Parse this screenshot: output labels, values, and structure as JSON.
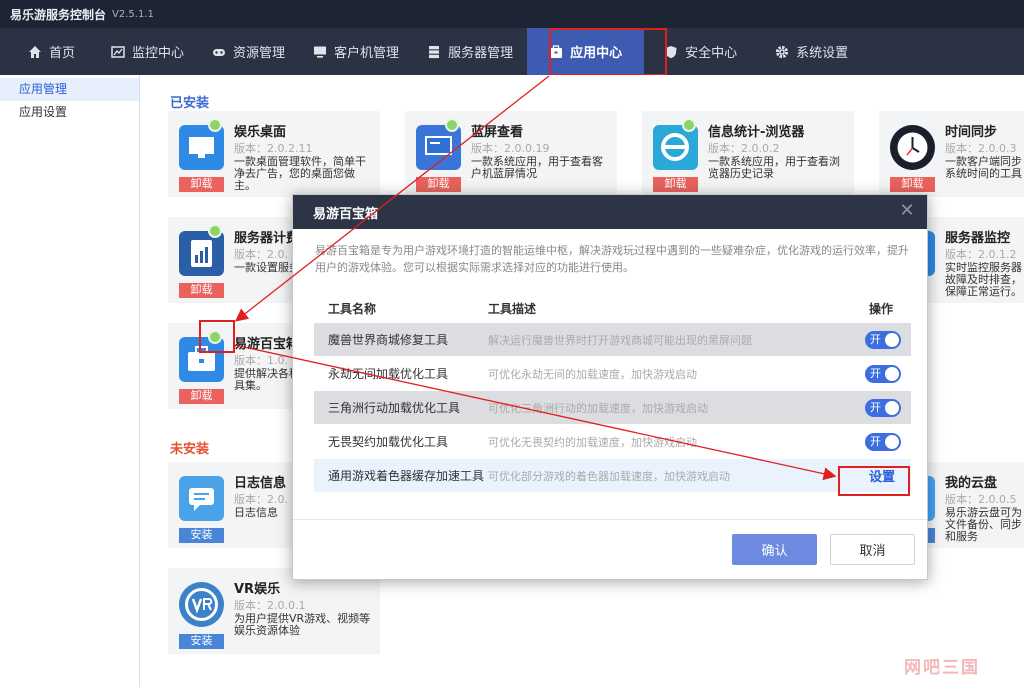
{
  "titlebar": {
    "title": "易乐游服务控制台",
    "version": "V2.5.1.1"
  },
  "nav": [
    {
      "label": "首页",
      "icon": "home-icon"
    },
    {
      "label": "监控中心",
      "icon": "monitor-chart-icon"
    },
    {
      "label": "资源管理",
      "icon": "gamepad-icon"
    },
    {
      "label": "客户机管理",
      "icon": "desktop-icon"
    },
    {
      "label": "服务器管理",
      "icon": "server-icon"
    },
    {
      "label": "应用中心",
      "icon": "box-icon",
      "active": true
    },
    {
      "label": "安全中心",
      "icon": "shield-icon"
    },
    {
      "label": "系统设置",
      "icon": "gear-icon"
    }
  ],
  "sidebar": {
    "items": [
      {
        "label": "应用管理",
        "active": true
      },
      {
        "label": "应用设置"
      }
    ]
  },
  "main": {
    "installed_title": "已安装",
    "uninstalled_title": "未安装",
    "uninstall_label": "卸载",
    "install_label": "安装",
    "installed": [
      {
        "name": "娱乐桌面",
        "version": "版本：2.0.2.11",
        "desc": "一款桌面管理软件，简单干净去广告，您的桌面您做主。",
        "icon": "monitor-app-icon"
      },
      {
        "name": "蓝屏查看",
        "version": "版本：2.0.0.19",
        "desc": "一款系统应用，用于查看客户机蓝屏情况",
        "icon": "bluescreen-app-icon"
      },
      {
        "name": "信息统计-浏览器",
        "version": "版本：2.0.0.2",
        "desc": "一款系统应用，用于查看浏览器历史记录",
        "icon": "browser-app-icon"
      },
      {
        "name": "时间同步",
        "version": "版本：2.0.0.3",
        "desc": "一款客户端同步系统时间的工具",
        "icon": "clock-app-icon"
      },
      {
        "name": "服务器计费",
        "version": "版本：2.0.",
        "desc": "一款设置服务器的工具",
        "icon": "billing-app-icon"
      },
      {
        "name": "服务器监控",
        "version": "版本：2.0.1.2",
        "desc": "实时监控服务器故障及时排查，保障正常运行。",
        "icon": "server-monitor-app-icon"
      },
      {
        "name": "易游百宝箱",
        "version": "版本：1.0.",
        "desc": "提供解决各种游戏问题的工具集。",
        "icon": "toolbox-app-icon"
      }
    ],
    "uninstalled": [
      {
        "name": "日志信息",
        "version": "版本：2.0.",
        "desc": "日志信息",
        "icon": "log-app-icon"
      },
      {
        "name": "我的云盘",
        "version": "版本：2.0.0.5",
        "desc": "易乐游云盘可为文件备份、同步和服务",
        "icon": "cloud-app-icon"
      },
      {
        "name": "VR娱乐",
        "version": "版本：2.0.0.1",
        "desc": "为用户提供VR游戏、视频等娱乐资源体验",
        "icon": "vr-app-icon"
      }
    ]
  },
  "modal": {
    "title": "易游百宝箱",
    "intro": "易游百宝箱是专为用户游戏环境打造的智能运维中枢，解决游戏玩过程中遇到的一些疑难杂症，优化游戏的运行效率，提升用户的游戏体验。您可以根据实际需求选择对应的功能进行使用。",
    "col_name": "工具名称",
    "col_desc": "工具描述",
    "col_op": "操作",
    "toggle_on": "开",
    "rows": [
      {
        "name": "魔兽世界商城修复工具",
        "desc": "解决运行魔兽世界时打开游戏商城可能出现的黑屏问题",
        "op": "toggle"
      },
      {
        "name": "永劫无间加载优化工具",
        "desc": "可优化永劫无间的加载速度，加快游戏启动",
        "op": "toggle"
      },
      {
        "name": "三角洲行动加载优化工具",
        "desc": "可优化三角洲行动的加载速度，加快游戏启动",
        "op": "toggle"
      },
      {
        "name": "无畏契约加载优化工具",
        "desc": "可优化无畏契约的加载速度，加快游戏启动",
        "op": "toggle"
      },
      {
        "name": "通用游戏着色器缓存加速工具",
        "desc": "可优化部分游戏的着色器加载速度，加快游戏启动",
        "op": "link",
        "link_label": "设置"
      }
    ],
    "ok_label": "确认",
    "cancel_label": "取消"
  },
  "watermark": "网吧三国",
  "colors": {
    "nav_bg": "#2a3243",
    "active_nav": "#3c5bb1",
    "accent": "#3d6ee0",
    "highlight": "#e02020"
  }
}
